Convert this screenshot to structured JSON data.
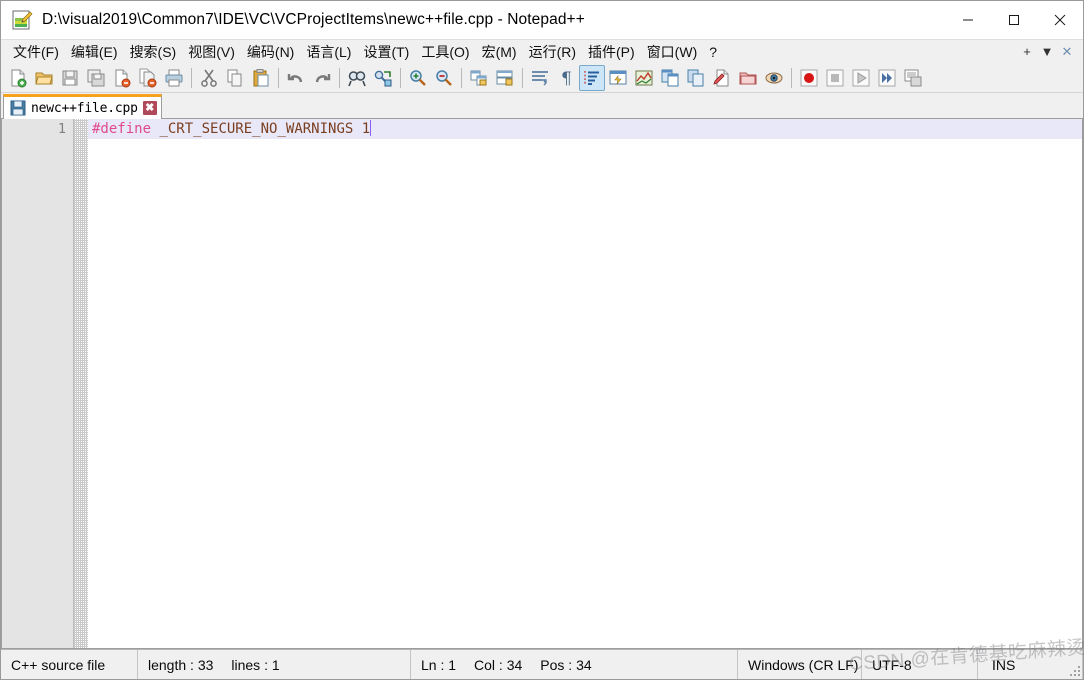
{
  "window": {
    "title": "D:\\visual2019\\Common7\\IDE\\VC\\VCProjectItems\\newc++file.cpp - Notepad++",
    "app_icon": "notepad-plus-plus-icon",
    "controls": {
      "minimize": "minimize-icon",
      "maximize": "maximize-icon",
      "close": "close-icon"
    }
  },
  "menubar": {
    "items": [
      {
        "label": "文件(F)",
        "name": "menu-file"
      },
      {
        "label": "编辑(E)",
        "name": "menu-edit"
      },
      {
        "label": "搜索(S)",
        "name": "menu-search"
      },
      {
        "label": "视图(V)",
        "name": "menu-view"
      },
      {
        "label": "编码(N)",
        "name": "menu-encoding"
      },
      {
        "label": "语言(L)",
        "name": "menu-language"
      },
      {
        "label": "设置(T)",
        "name": "menu-settings"
      },
      {
        "label": "工具(O)",
        "name": "menu-tools"
      },
      {
        "label": "宏(M)",
        "name": "menu-macro"
      },
      {
        "label": "运行(R)",
        "name": "menu-run"
      },
      {
        "label": "插件(P)",
        "name": "menu-plugins"
      },
      {
        "label": "窗口(W)",
        "name": "menu-window"
      },
      {
        "label": "?",
        "name": "menu-help"
      }
    ],
    "right_controls": [
      {
        "glyph": "+",
        "name": "doc-new-control"
      },
      {
        "glyph": "▼",
        "name": "doc-list-control"
      },
      {
        "glyph": "✕",
        "name": "doc-close-control"
      }
    ]
  },
  "toolbar": {
    "buttons": [
      {
        "name": "new-file-icon",
        "sep_after": false
      },
      {
        "name": "open-file-icon",
        "sep_after": false
      },
      {
        "name": "save-icon",
        "sep_after": false
      },
      {
        "name": "save-all-icon",
        "sep_after": false
      },
      {
        "name": "close-file-icon",
        "sep_after": false
      },
      {
        "name": "close-all-files-icon",
        "sep_after": false
      },
      {
        "name": "print-icon",
        "sep_after": true
      },
      {
        "name": "cut-icon",
        "sep_after": false
      },
      {
        "name": "copy-icon",
        "sep_after": false
      },
      {
        "name": "paste-icon",
        "sep_after": true
      },
      {
        "name": "undo-icon",
        "sep_after": false
      },
      {
        "name": "redo-icon",
        "sep_after": true
      },
      {
        "name": "find-icon",
        "sep_after": false
      },
      {
        "name": "replace-icon",
        "sep_after": true
      },
      {
        "name": "zoom-in-icon",
        "sep_after": false
      },
      {
        "name": "zoom-out-icon",
        "sep_after": true
      },
      {
        "name": "sync-vertical-scroll-icon",
        "sep_after": false
      },
      {
        "name": "sync-horizontal-scroll-icon",
        "sep_after": true
      },
      {
        "name": "word-wrap-icon",
        "sep_after": false
      },
      {
        "name": "show-all-chars-icon",
        "sep_after": false
      },
      {
        "name": "indent-guide-icon",
        "sep_after": false,
        "active": true
      },
      {
        "name": "user-defined-dialog-icon",
        "sep_after": false
      },
      {
        "name": "document-map-icon",
        "sep_after": false
      },
      {
        "name": "function-list-icon",
        "sep_after": false
      },
      {
        "name": "folder-as-workspace-icon",
        "sep_after": false
      },
      {
        "name": "monitoring-icon",
        "sep_after": false
      },
      {
        "name": "document-folder-icon",
        "sep_after": false
      },
      {
        "name": "eye-preview-icon",
        "sep_after": true
      },
      {
        "name": "record-macro-icon",
        "sep_after": false
      },
      {
        "name": "stop-macro-icon",
        "sep_after": false
      },
      {
        "name": "play-macro-icon",
        "sep_after": false
      },
      {
        "name": "run-macro-multiple-icon",
        "sep_after": false
      },
      {
        "name": "run-dialog-icon",
        "sep_after": false
      }
    ]
  },
  "tabs": [
    {
      "label": "newc++file.cpp",
      "icon": "saved-file-icon",
      "close_glyph": "✖",
      "active": true
    }
  ],
  "editor": {
    "line_numbers": [
      "1"
    ],
    "code": {
      "directive": "#define",
      "space": " ",
      "identifier": "_CRT_SECURE_NO_WARNINGS",
      "space2": " ",
      "number": "1"
    },
    "colors": {
      "directive": "#e04a8c",
      "identifier": "#7b3f20",
      "current_line_bg": "#e8e8f8",
      "caret": "#8b5cf6",
      "gutter_bg": "#e4e4e4",
      "gutter_text": "#808080"
    }
  },
  "statusbar": {
    "file_type": "C++ source file",
    "length_label": "length : 33",
    "lines_label": "lines : 1",
    "ln": "Ln : 1",
    "col": "Col : 34",
    "pos": "Pos : 34",
    "eol": "Windows (CR LF)",
    "encoding": "UTF-8",
    "insert_mode": "INS",
    "resize_grip": "resize-grip-icon"
  },
  "watermark": {
    "text": "CSDN @在肯德基吃麻辣烫"
  }
}
